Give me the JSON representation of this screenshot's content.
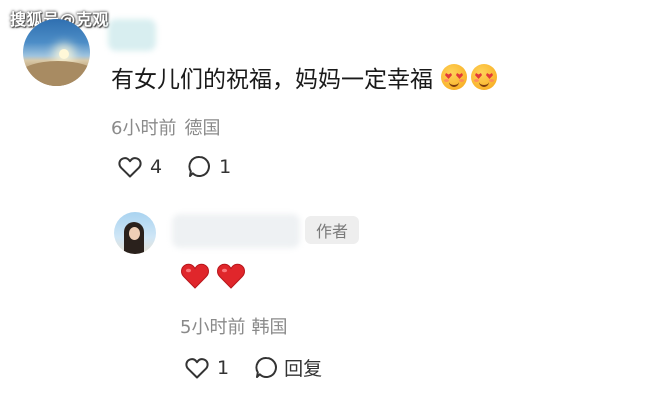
{
  "watermark": "搜狐号@克观",
  "comment": {
    "text": "有女儿们的祝福，妈妈一定幸福",
    "emojis": [
      "smiling-face-with-hearts-emoji",
      "smiling-face-with-hearts-emoji"
    ],
    "time": "6小时前",
    "location": "德国",
    "like_count": "4",
    "reply_count": "1"
  },
  "reply": {
    "author_badge": "作者",
    "emojis": [
      "red-heart-emoji",
      "red-heart-emoji"
    ],
    "time": "5小时前",
    "location": "韩国",
    "like_count": "1",
    "reply_label": "回复"
  },
  "colors": {
    "meta_gray": "#8a8a8a",
    "heart_red": "#e0262b",
    "badge_bg": "#eeeeee"
  }
}
